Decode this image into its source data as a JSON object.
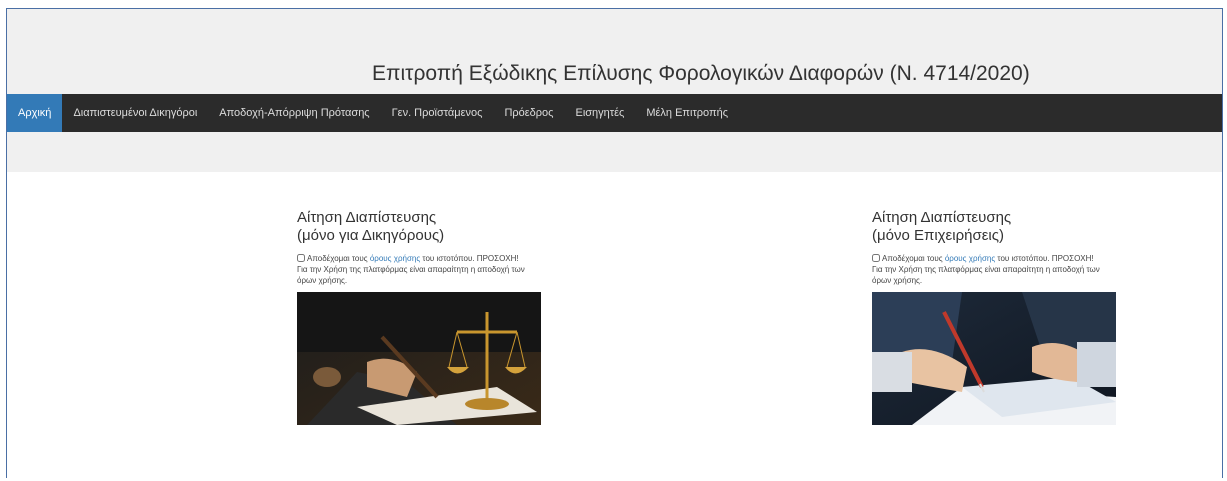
{
  "site": {
    "title": "Επιτροπή Εξώδικης Επίλυσης Φορολογικών Διαφορών (Ν. 4714/2020)"
  },
  "nav": {
    "items": [
      {
        "label": "Αρχική",
        "active": true
      },
      {
        "label": "Διαπιστευμένοι Δικηγόροι",
        "active": false
      },
      {
        "label": "Αποδοχή-Απόρριψη Πρότασης",
        "active": false
      },
      {
        "label": "Γεν. Προϊστάμενος",
        "active": false
      },
      {
        "label": "Πρόεδρος",
        "active": false
      },
      {
        "label": "Εισηγητές",
        "active": false
      },
      {
        "label": "Μέλη Επιτροπής",
        "active": false
      }
    ],
    "active_color": "#337ab7",
    "bar_color": "#2b2b2b"
  },
  "cards": [
    {
      "title_line1": "Αίτηση Διαπίστευσης",
      "title_line2": "(μόνο για Δικηγόρους)",
      "terms_prefix": "Αποδέχομαι τους",
      "terms_link": "όρους χρήσης",
      "terms_suffix": "του ιστοτόπου. ΠΡΟΣΟΧΗ! Για την Χρήση της πλατφόρμας είναι απαραίτητη η αποδοχή των όρων χρήσης.",
      "image_icon": "lawyer-scales-image"
    },
    {
      "title_line1": "Αίτηση Διαπίστευσης",
      "title_line2": "(μόνο Επιχειρήσεις)",
      "terms_prefix": "Αποδέχομαι τους",
      "terms_link": "όρους χρήσης",
      "terms_suffix": "του ιστοτόπου. ΠΡΟΣΟΧΗ! Για την Χρήση της πλατφόρμας είναι απαραίτητη η αποδοχή των όρων χρήσης.",
      "image_icon": "business-signing-image"
    }
  ]
}
